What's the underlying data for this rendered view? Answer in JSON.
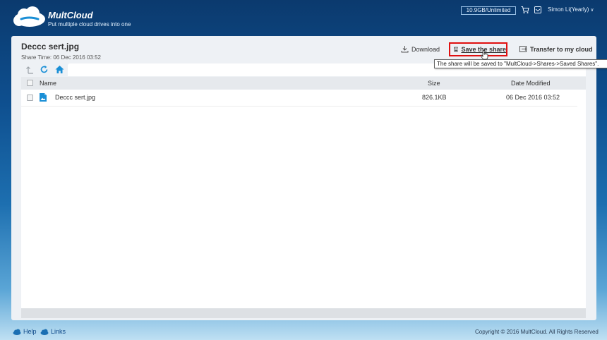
{
  "header": {
    "brand": "MultCloud",
    "tagline": "Put multiple cloud drives into one",
    "storage": "10.9GB/Unlimited",
    "user": "Simon Li(Yearly)",
    "icons": [
      "cloud-logo",
      "cart-icon",
      "message-icon",
      "chevron-down-icon"
    ]
  },
  "share": {
    "file_title": "Deccc sert.jpg",
    "share_time": "Share Time: 06 Dec 2016 03:52"
  },
  "actions": {
    "download": "Download",
    "save": "Save the share",
    "transfer": "Transfer to my cloud"
  },
  "tooltip": "The share will be saved to \"MultCloud->Shares->Saved Shares\".",
  "list": {
    "columns": {
      "name": "Name",
      "size": "Size",
      "date": "Date Modified"
    },
    "rows": [
      {
        "name": "Deccc sert.jpg",
        "size": "826.1KB",
        "date": "06 Dec 2016 03:52"
      }
    ]
  },
  "footer": {
    "help": "Help",
    "links": "Links",
    "copyright": "Copyright © 2016 MultCloud. All Rights Reserved"
  },
  "colors": {
    "accent_blue": "#1a8fd6",
    "highlight_red": "#e01010",
    "header_dark": "#0b3a6e"
  }
}
